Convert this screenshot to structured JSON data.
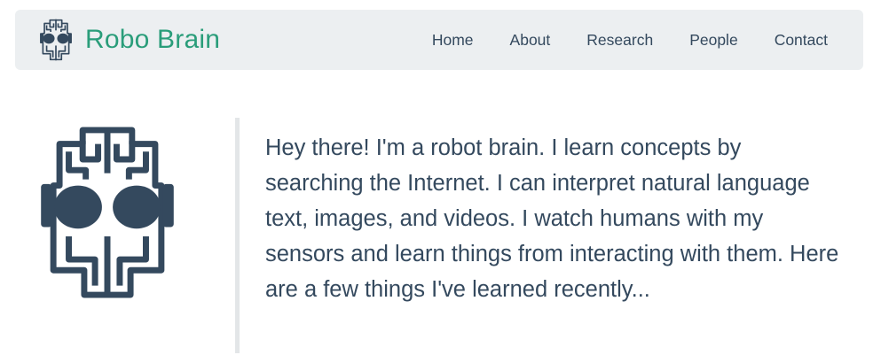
{
  "navbar": {
    "brand_name": "Robo Brain",
    "brand_color": "#2a9d7a",
    "logo_icon": "robot-brain-icon",
    "links": [
      {
        "label": "Home"
      },
      {
        "label": "About"
      },
      {
        "label": "Research"
      },
      {
        "label": "People"
      },
      {
        "label": "Contact"
      }
    ]
  },
  "hero": {
    "icon": "robot-brain-icon",
    "icon_color": "#34495e",
    "text": "Hey there! I'm a robot brain. I learn concepts by searching the Internet. I can interpret natural language text, images, and videos. I watch humans with my sensors and learn things from interacting with them. Here are a few things I've learned recently..."
  }
}
